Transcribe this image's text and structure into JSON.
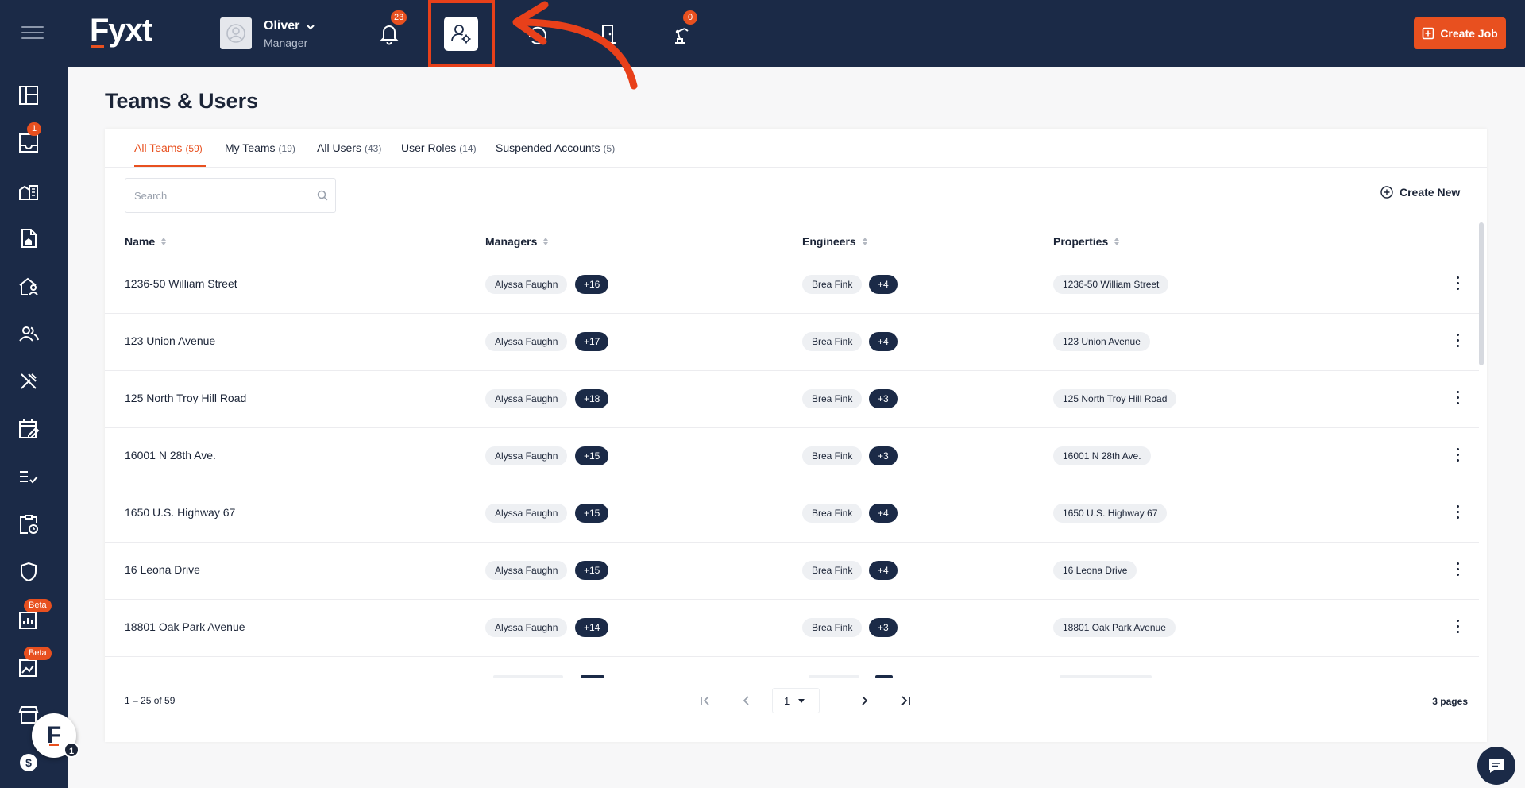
{
  "header": {
    "logo": "Fyxt",
    "user_name": "Oliver",
    "user_role": "Manager",
    "notifications_count": "23",
    "robot_count": "0",
    "create_job_label": "Create Job"
  },
  "sidebar": {
    "items": [
      {
        "icon": "dashboard-icon"
      },
      {
        "icon": "inbox-icon",
        "badge": "1"
      },
      {
        "icon": "buildings-icon"
      },
      {
        "icon": "document-building-icon"
      },
      {
        "icon": "tenant-icon"
      },
      {
        "icon": "people-icon"
      },
      {
        "icon": "tools-icon"
      },
      {
        "icon": "schedule-icon"
      },
      {
        "icon": "checklist-icon"
      },
      {
        "icon": "clipboard-clock-icon"
      },
      {
        "icon": "shield-icon"
      },
      {
        "icon": "report-icon",
        "badge": "Beta"
      },
      {
        "icon": "image-chart-icon",
        "badge": "Beta"
      },
      {
        "icon": "store-icon"
      },
      {
        "icon": "dollar-icon"
      }
    ],
    "fab_letter": "F",
    "fab_badge": "1"
  },
  "page": {
    "title": "Teams & Users"
  },
  "tabs": [
    {
      "label": "All Teams",
      "count": "(59)"
    },
    {
      "label": "My Teams",
      "count": "(19)"
    },
    {
      "label": "All Users",
      "count": "(43)"
    },
    {
      "label": "User Roles",
      "count": "(14)"
    },
    {
      "label": "Suspended Accounts",
      "count": "(5)"
    }
  ],
  "search": {
    "placeholder": "Search",
    "value": ""
  },
  "create_new_label": "Create New",
  "table": {
    "columns": [
      "Name",
      "Managers",
      "Engineers",
      "Properties"
    ],
    "rows": [
      {
        "name": "1236-50 William Street",
        "manager": "Alyssa Faughn",
        "manager_more": "+16",
        "engineer": "Brea Fink",
        "engineer_more": "+4",
        "property": "1236-50 William Street"
      },
      {
        "name": "123 Union Avenue",
        "manager": "Alyssa Faughn",
        "manager_more": "+17",
        "engineer": "Brea Fink",
        "engineer_more": "+4",
        "property": "123 Union Avenue"
      },
      {
        "name": "125 North Troy Hill Road",
        "manager": "Alyssa Faughn",
        "manager_more": "+18",
        "engineer": "Brea Fink",
        "engineer_more": "+3",
        "property": "125 North Troy Hill Road"
      },
      {
        "name": "16001 N 28th Ave.",
        "manager": "Alyssa Faughn",
        "manager_more": "+15",
        "engineer": "Brea Fink",
        "engineer_more": "+3",
        "property": "16001 N 28th Ave."
      },
      {
        "name": "1650 U.S. Highway 67",
        "manager": "Alyssa Faughn",
        "manager_more": "+15",
        "engineer": "Brea Fink",
        "engineer_more": "+4",
        "property": "1650 U.S. Highway 67"
      },
      {
        "name": "16 Leona Drive",
        "manager": "Alyssa Faughn",
        "manager_more": "+15",
        "engineer": "Brea Fink",
        "engineer_more": "+4",
        "property": "16 Leona Drive"
      },
      {
        "name": "18801 Oak Park Avenue",
        "manager": "Alyssa Faughn",
        "manager_more": "+14",
        "engineer": "Brea Fink",
        "engineer_more": "+3",
        "property": "18801 Oak Park Avenue"
      }
    ]
  },
  "pagination": {
    "range": "1 – 25 of 59",
    "current_page": "1",
    "pages_label": "3 pages"
  },
  "colors": {
    "navy": "#1b2a47",
    "accent": "#e8501f",
    "highlight": "#e8401a"
  }
}
